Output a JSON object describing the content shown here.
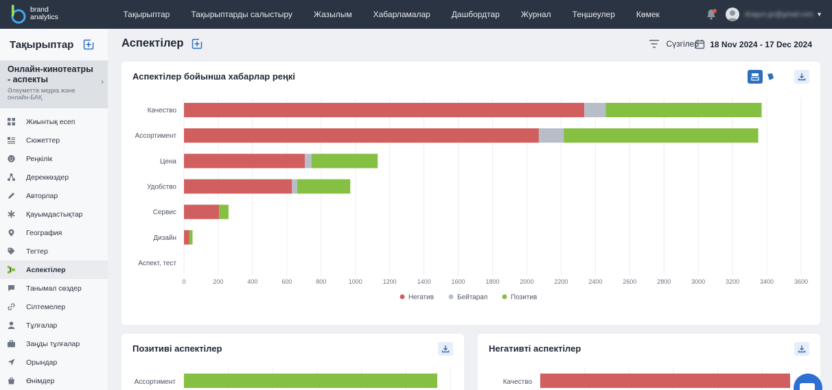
{
  "brand": {
    "line1": "brand",
    "line2": "analytics"
  },
  "nav": [
    "Тақырыптар",
    "Тақырыптарды салыстыру",
    "Жазылым",
    "Хабарламалар",
    "Дашбордтар",
    "Журнал",
    "Теңшеулер",
    "Көмек"
  ],
  "user": {
    "email": "dragun.gv@gmail.com"
  },
  "sidebar": {
    "title": "Тақырыптар",
    "project": {
      "name": "Онлайн-кинотеатры - аспекты",
      "sub": "Әлеуметтік медиа және онлайн-БАҚ"
    },
    "items": [
      {
        "label": "Жиынтық есеп",
        "icon": "grid-icon"
      },
      {
        "label": "Сюжеттер",
        "icon": "list-icon"
      },
      {
        "label": "Реңкілік",
        "icon": "smile-icon"
      },
      {
        "label": "Дереккөздер",
        "icon": "network-icon"
      },
      {
        "label": "Авторлар",
        "icon": "pen-icon"
      },
      {
        "label": "Қауымдастықтар",
        "icon": "asterisk-icon"
      },
      {
        "label": "География",
        "icon": "pin-icon"
      },
      {
        "label": "Тегтер",
        "icon": "tag-icon"
      },
      {
        "label": "Аспектілер",
        "icon": "aspects-icon"
      },
      {
        "label": "Танымал сөздер",
        "icon": "chat-icon"
      },
      {
        "label": "Сілтемелер",
        "icon": "link-icon"
      },
      {
        "label": "Тұлғалар",
        "icon": "person-icon"
      },
      {
        "label": "Заңды тұлғалар",
        "icon": "briefcase-icon"
      },
      {
        "label": "Орындар",
        "icon": "location-arrow-icon"
      },
      {
        "label": "Өнімдер",
        "icon": "bag-icon"
      }
    ],
    "active_index": 8
  },
  "page": {
    "title": "Аспектілер",
    "filters_label": "Сүзгілер",
    "date_range": "18 Nov 2024 - 17 Dec 2024"
  },
  "colors": {
    "negative": "#d25f5f",
    "neutral": "#b8bec8",
    "positive": "#86c043",
    "accent": "#2d6fbd"
  },
  "cards": {
    "main_title": "Аспектілер бойынша хабарлар реңкі",
    "positive_title": "Позитиві аспектілер",
    "negative_title": "Негативті аспектілер"
  },
  "chart_data": [
    {
      "type": "bar",
      "orientation": "horizontal",
      "stacked": true,
      "categories": [
        "Качество",
        "Ассортимент",
        "Цена",
        "Удобство",
        "Сервис",
        "Дизайн",
        "Аспект, тест"
      ],
      "series": [
        {
          "name": "Негатив",
          "values": [
            2335,
            2070,
            705,
            630,
            205,
            30,
            0
          ]
        },
        {
          "name": "Бейтарап",
          "values": [
            125,
            145,
            40,
            30,
            0,
            0,
            0
          ]
        },
        {
          "name": "Позитив",
          "values": [
            910,
            1135,
            385,
            310,
            55,
            20,
            0
          ]
        }
      ],
      "xlim": [
        0,
        3600
      ],
      "xticks": [
        0,
        200,
        400,
        600,
        800,
        1000,
        1200,
        1400,
        1600,
        1800,
        2000,
        2200,
        2400,
        2600,
        2800,
        3000,
        3200,
        3400,
        3600
      ],
      "grid": true,
      "legend": "bottom"
    }
  ],
  "mini_positive": {
    "categories": [
      "Ассортимент"
    ],
    "values": [
      1
    ]
  },
  "mini_negative": {
    "categories": [
      "Качество"
    ],
    "values": [
      1
    ]
  }
}
